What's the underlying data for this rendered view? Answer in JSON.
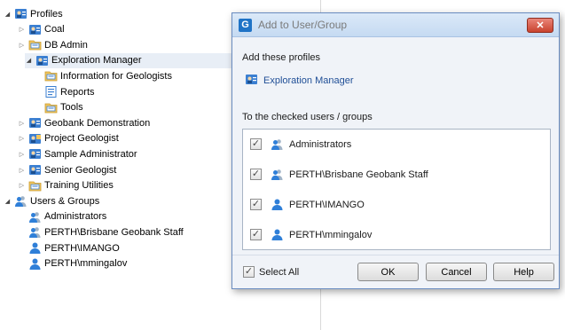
{
  "tree": [
    {
      "label": "Profiles",
      "level": 0,
      "expander": "open",
      "icon": "profile-icon",
      "name": "tree-node-profiles"
    },
    {
      "label": "Coal",
      "level": 1,
      "expander": "closed",
      "icon": "profile-icon",
      "name": "tree-node-coal"
    },
    {
      "label": "DB Admin",
      "level": 1,
      "expander": "closed",
      "icon": "folder-icon",
      "name": "tree-node-db-admin"
    },
    {
      "label": "Exploration Manager",
      "level": 1,
      "expander": "open",
      "icon": "profile-icon",
      "name": "tree-node-exploration-manager",
      "selected": true
    },
    {
      "label": "Information for Geologists",
      "level": 2,
      "expander": "none",
      "icon": "folder-icon",
      "name": "tree-node-information-for-geologists"
    },
    {
      "label": "Reports",
      "level": 2,
      "expander": "none",
      "icon": "report-icon",
      "name": "tree-node-reports"
    },
    {
      "label": "Tools",
      "level": 2,
      "expander": "none",
      "icon": "folder-icon",
      "name": "tree-node-tools"
    },
    {
      "label": "Geobank Demonstration",
      "level": 1,
      "expander": "closed",
      "icon": "profile-icon",
      "name": "tree-node-geobank-demonstration"
    },
    {
      "label": "Project Geologist",
      "level": 1,
      "expander": "closed",
      "icon": "project-icon",
      "name": "tree-node-project-geologist"
    },
    {
      "label": "Sample Administrator",
      "level": 1,
      "expander": "closed",
      "icon": "profile-icon",
      "name": "tree-node-sample-administrator"
    },
    {
      "label": "Senior Geologist",
      "level": 1,
      "expander": "closed",
      "icon": "profile-icon",
      "name": "tree-node-senior-geologist"
    },
    {
      "label": "Training Utilities",
      "level": 1,
      "expander": "closed",
      "icon": "folder-icon",
      "name": "tree-node-training-utilities"
    },
    {
      "label": "Users & Groups",
      "level": 0,
      "expander": "open",
      "icon": "group-icon",
      "name": "tree-node-users-groups"
    },
    {
      "label": "Administrators",
      "level": 1,
      "expander": "none",
      "icon": "group-icon",
      "name": "tree-node-administrators"
    },
    {
      "label": "PERTH\\Brisbane Geobank Staff",
      "level": 1,
      "expander": "none",
      "icon": "group-icon",
      "name": "tree-node-brisbane-geobank-staff"
    },
    {
      "label": "PERTH\\IMANGO",
      "level": 1,
      "expander": "none",
      "icon": "user-icon",
      "name": "tree-node-imango"
    },
    {
      "label": "PERTH\\mmingalov",
      "level": 1,
      "expander": "none",
      "icon": "user-icon",
      "name": "tree-node-mmingalov"
    }
  ],
  "dialog": {
    "app_icon_letter": "G",
    "title": "Add to User/Group",
    "close_glyph": "✕",
    "add_profiles_label": "Add these profiles",
    "profile_name": "Exploration Manager",
    "checked_label": "To the checked users / groups",
    "users": [
      {
        "label": "Administrators",
        "checked": true,
        "icon": "group-icon"
      },
      {
        "label": "PERTH\\Brisbane Geobank Staff",
        "checked": true,
        "icon": "group-icon"
      },
      {
        "label": "PERTH\\IMANGO",
        "checked": true,
        "icon": "user-icon"
      },
      {
        "label": "PERTH\\mmingalov",
        "checked": true,
        "icon": "user-icon"
      }
    ],
    "select_all_label": "Select All",
    "select_all_checked": true,
    "ok_label": "OK",
    "cancel_label": "Cancel",
    "help_label": "Help"
  },
  "colors": {
    "accent": "#1f73c6",
    "selection": "#e8eef6",
    "close_button": "#c9432f"
  }
}
